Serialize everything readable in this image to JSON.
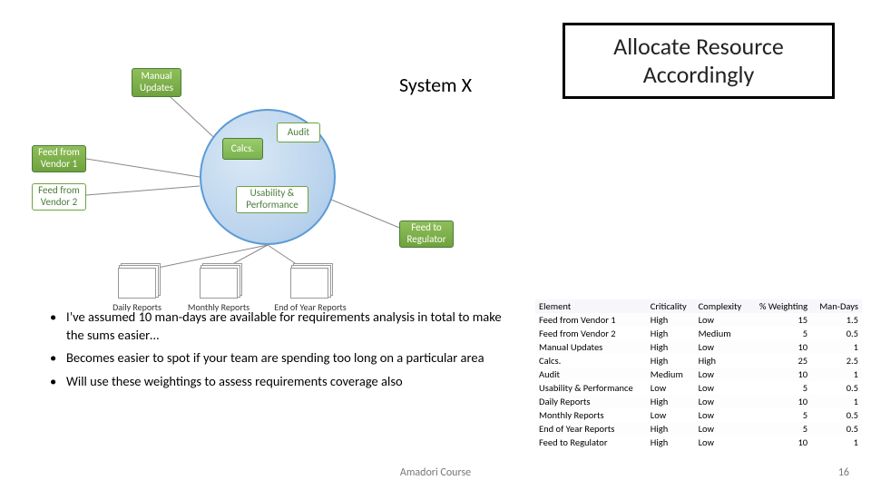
{
  "title_line1": "Allocate Resource",
  "title_line2": "Accordingly",
  "system_label": "System X",
  "diagram": {
    "manual": "Manual Updates",
    "feed1": "Feed from Vendor 1",
    "feed2": "Feed from Vendor 2",
    "calcs": "Calcs.",
    "audit": "Audit",
    "usability": "Usability & Performance",
    "feedreg": "Feed to Regulator",
    "daily": "Daily Reports",
    "monthly": "Monthly Reports",
    "eoy": "End of Year Reports"
  },
  "bullets": {
    "b1": "I’ve assumed 10 man-days are available for requirements analysis in total to make the sums easier…",
    "b2": "Becomes easier to spot if your team are spending too long on a particular area",
    "b3": "Will use these weightings to assess requirements coverage also"
  },
  "table": {
    "headers": {
      "el": "Element",
      "crit": "Criticality",
      "comp": "Complexity",
      "wt": "% Weighting",
      "md": "Man-Days"
    },
    "rows": [
      {
        "el": "Feed from Vendor 1",
        "crit": "High",
        "comp": "Low",
        "wt": "15",
        "md": "1.5"
      },
      {
        "el": "Feed from Vendor 2",
        "crit": "High",
        "comp": "Medium",
        "wt": "5",
        "md": "0.5"
      },
      {
        "el": "Manual Updates",
        "crit": "High",
        "comp": "Low",
        "wt": "10",
        "md": "1"
      },
      {
        "el": "Calcs.",
        "crit": "High",
        "comp": "High",
        "wt": "25",
        "md": "2.5"
      },
      {
        "el": "Audit",
        "crit": "Medium",
        "comp": "Low",
        "wt": "10",
        "md": "1"
      },
      {
        "el": "Usability & Performance",
        "crit": "Low",
        "comp": "Low",
        "wt": "5",
        "md": "0.5"
      },
      {
        "el": "Daily Reports",
        "crit": "High",
        "comp": "Low",
        "wt": "10",
        "md": "1"
      },
      {
        "el": "Monthly Reports",
        "crit": "Low",
        "comp": "Low",
        "wt": "5",
        "md": "0.5"
      },
      {
        "el": "End of Year Reports",
        "crit": "High",
        "comp": "Low",
        "wt": "5",
        "md": "0.5"
      },
      {
        "el": "Feed to Regulator",
        "crit": "High",
        "comp": "Low",
        "wt": "10",
        "md": "1"
      }
    ]
  },
  "footer": {
    "course": "Amadori Course",
    "page": "16"
  }
}
